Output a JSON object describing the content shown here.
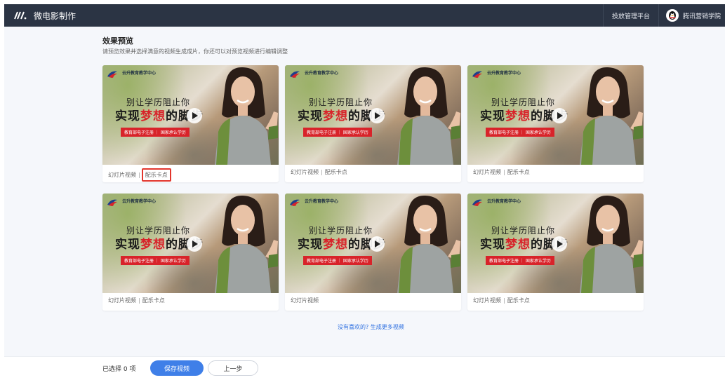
{
  "header": {
    "title": "微电影制作",
    "platform_link": "投放管理平台",
    "account_name": "腾讯营销学院"
  },
  "preview": {
    "title": "效果预览",
    "subtitle": "请预览效果并选择满意的视频生成成片，你还可以对预览视频进行编辑调整",
    "cards": [
      {
        "types": [
          "幻灯片视频",
          "配乐卡点"
        ],
        "highlighted": true
      },
      {
        "types": [
          "幻灯片视频",
          "配乐卡点"
        ],
        "highlighted": false
      },
      {
        "types": [
          "幻灯片视频",
          "配乐卡点"
        ],
        "highlighted": false
      },
      {
        "types": [
          "幻灯片视频",
          "配乐卡点"
        ],
        "highlighted": false
      },
      {
        "types": [
          "幻灯片视频"
        ],
        "highlighted": false
      },
      {
        "types": [
          "幻灯片视频",
          "配乐卡点"
        ],
        "highlighted": false
      }
    ],
    "thumbnail": {
      "brand": "云升教育教学中心",
      "headline_1": "别让学历阻止你",
      "headline_2_a": "实现",
      "headline_2_b": "梦想",
      "headline_2_c": "的脚步",
      "tagline": "教育部电子注册 ｜ 国家承认学历"
    },
    "more_link": "没有喜欢的? 生成更多视频"
  },
  "footer": {
    "selected_text": "已选择 0 项",
    "save_label": "保存视频",
    "prev_label": "上一步"
  },
  "colors": {
    "topbar": "#2b3444",
    "accent": "#3f7fe8",
    "highlight": "#e2352c",
    "headline_red": "#d8232a"
  }
}
